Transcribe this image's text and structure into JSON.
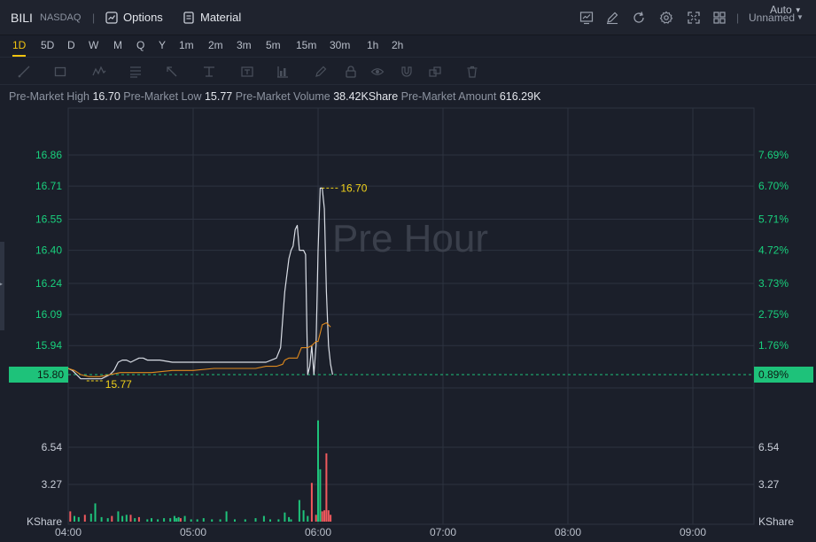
{
  "header": {
    "symbol": "BILI",
    "exchange": "NASDAQ",
    "separator": "|",
    "options_label": "Options",
    "material_label": "Material",
    "layout_name": "Unnamed",
    "right_icons": [
      "chart-icon",
      "edit-icon",
      "refresh-icon",
      "gear-icon",
      "fullscreen-icon",
      "grid-icon"
    ]
  },
  "periods": {
    "items": [
      "1D",
      "5D",
      "D",
      "W",
      "M",
      "Q",
      "Y",
      "1m",
      "2m",
      "3m",
      "5m",
      "15m",
      "30m",
      "1h",
      "2h"
    ],
    "active": "1D",
    "auto_label": "Auto"
  },
  "drawing_tools": [
    "trend-line-icon",
    "rectangle-icon",
    "pattern-icon",
    "fib-icon",
    "arrow-icon",
    "measure-icon",
    "text-icon",
    "bar-pattern-icon",
    "pencil-icon",
    "lock-icon",
    "eye-icon",
    "magnet-icon",
    "link-icon",
    "trash-icon"
  ],
  "premarket": {
    "high_label": "Pre-Market High",
    "high_value": "16.70",
    "low_label": "Pre-Market Low",
    "low_value": "15.77",
    "volume_label": "Pre-Market Volume",
    "volume_value": "38.42KShare",
    "amount_label": "Pre-Market Amount",
    "amount_value": "616.29K"
  },
  "colors": {
    "background": "#1b1f2a",
    "grid": "#2d3340",
    "price_line": "#d9dde5",
    "avg_line": "#e08a1e",
    "up": "#1ec27a",
    "down": "#f0595d",
    "label_yellow": "#f1d21a",
    "axis_green": "#19d07d",
    "current_badge": "#1ec27a",
    "watermark": "#3a3f4b"
  },
  "chart_data": {
    "type": "line",
    "watermark": "Pre Hour",
    "x_ticks": [
      "04:00",
      "05:00",
      "06:00",
      "07:00",
      "08:00",
      "09:00"
    ],
    "xlim": [
      "04:00",
      "09:30"
    ],
    "y_left_ticks": [
      "16.86",
      "16.71",
      "16.55",
      "16.40",
      "16.24",
      "16.09",
      "15.94"
    ],
    "y_right_ticks": [
      "7.69%",
      "6.70%",
      "5.71%",
      "4.72%",
      "3.73%",
      "2.75%",
      "1.76%"
    ],
    "ylim": [
      15.74,
      16.94
    ],
    "reference_price": 15.8,
    "current_price_label": "15.80",
    "current_pct_label": "0.89%",
    "high_marker": {
      "time": "06:01",
      "value": 16.7,
      "label": "16.70"
    },
    "low_marker": {
      "time": "04:08",
      "value": 15.77,
      "label": "15.77"
    },
    "series": [
      {
        "role": "price",
        "x": [
          "04:00",
          "04:02",
          "04:04",
          "04:06",
          "04:08",
          "04:12",
          "04:16",
          "04:20",
          "04:22",
          "04:24",
          "04:26",
          "04:28",
          "04:30",
          "04:32",
          "04:34",
          "04:36",
          "04:38",
          "04:40",
          "04:44",
          "04:50",
          "04:55",
          "05:00",
          "05:05",
          "05:10",
          "05:15",
          "05:20",
          "05:25",
          "05:30",
          "05:35",
          "05:40",
          "05:42",
          "05:44",
          "05:46",
          "05:47",
          "05:48",
          "05:49",
          "05:50",
          "05:51",
          "05:52",
          "05:53",
          "05:54",
          "05:55",
          "05:56",
          "05:57",
          "05:58",
          "05:59",
          "06:00",
          "06:01",
          "06:02",
          "06:03",
          "06:04",
          "06:05",
          "06:06",
          "06:07"
        ],
        "values": [
          15.83,
          15.82,
          15.8,
          15.78,
          15.78,
          15.78,
          15.78,
          15.8,
          15.82,
          15.86,
          15.87,
          15.87,
          15.86,
          15.87,
          15.88,
          15.88,
          15.87,
          15.87,
          15.87,
          15.86,
          15.86,
          15.86,
          15.86,
          15.86,
          15.86,
          15.86,
          15.86,
          15.86,
          15.86,
          15.88,
          15.93,
          16.2,
          16.36,
          16.4,
          16.42,
          16.5,
          16.52,
          16.4,
          16.4,
          16.4,
          16.38,
          15.8,
          15.84,
          15.94,
          15.8,
          15.94,
          16.4,
          16.7,
          16.7,
          16.6,
          16.2,
          15.94,
          15.85,
          15.8
        ]
      },
      {
        "role": "average",
        "x": [
          "04:00",
          "04:03",
          "04:06",
          "04:10",
          "04:15",
          "04:20",
          "04:25",
          "04:30",
          "04:40",
          "04:50",
          "05:00",
          "05:10",
          "05:20",
          "05:30",
          "05:35",
          "05:40",
          "05:43",
          "05:44",
          "05:46",
          "05:50",
          "05:52",
          "05:55",
          "05:57",
          "05:58",
          "05:59",
          "06:00",
          "06:01",
          "06:02",
          "06:04",
          "06:05",
          "06:06"
        ],
        "values": [
          15.83,
          15.82,
          15.8,
          15.79,
          15.79,
          15.8,
          15.81,
          15.81,
          15.81,
          15.82,
          15.82,
          15.83,
          15.83,
          15.83,
          15.84,
          15.84,
          15.85,
          15.87,
          15.88,
          15.88,
          15.93,
          15.93,
          15.94,
          15.95,
          15.96,
          15.96,
          16.0,
          16.04,
          16.05,
          16.04,
          16.03
        ]
      }
    ],
    "volume": {
      "y_ticks": [
        "6.54",
        "3.27"
      ],
      "unit_label": "KShare",
      "ylim": [
        0,
        10.5
      ],
      "bars": [
        {
          "x": "04:01",
          "v": 0.9,
          "dir": "down"
        },
        {
          "x": "04:03",
          "v": 0.5,
          "dir": "up"
        },
        {
          "x": "04:05",
          "v": 0.4,
          "dir": "up"
        },
        {
          "x": "04:08",
          "v": 0.6,
          "dir": "down"
        },
        {
          "x": "04:11",
          "v": 0.7,
          "dir": "up"
        },
        {
          "x": "04:13",
          "v": 1.6,
          "dir": "up"
        },
        {
          "x": "04:16",
          "v": 0.4,
          "dir": "up"
        },
        {
          "x": "04:19",
          "v": 0.3,
          "dir": "up"
        },
        {
          "x": "04:21",
          "v": 0.5,
          "dir": "down"
        },
        {
          "x": "04:24",
          "v": 0.9,
          "dir": "up"
        },
        {
          "x": "04:26",
          "v": 0.5,
          "dir": "up"
        },
        {
          "x": "04:28",
          "v": 0.6,
          "dir": "up"
        },
        {
          "x": "04:30",
          "v": 0.6,
          "dir": "down"
        },
        {
          "x": "04:32",
          "v": 0.3,
          "dir": "up"
        },
        {
          "x": "04:34",
          "v": 0.4,
          "dir": "down"
        },
        {
          "x": "04:38",
          "v": 0.2,
          "dir": "up"
        },
        {
          "x": "04:40",
          "v": 0.3,
          "dir": "up"
        },
        {
          "x": "04:43",
          "v": 0.2,
          "dir": "up"
        },
        {
          "x": "04:46",
          "v": 0.3,
          "dir": "up"
        },
        {
          "x": "04:49",
          "v": 0.3,
          "dir": "up"
        },
        {
          "x": "04:51",
          "v": 0.5,
          "dir": "up"
        },
        {
          "x": "04:52",
          "v": 0.3,
          "dir": "up"
        },
        {
          "x": "04:53",
          "v": 0.4,
          "dir": "up"
        },
        {
          "x": "04:54",
          "v": 0.3,
          "dir": "down"
        },
        {
          "x": "04:56",
          "v": 0.5,
          "dir": "up"
        },
        {
          "x": "04:59",
          "v": 0.2,
          "dir": "up"
        },
        {
          "x": "05:02",
          "v": 0.2,
          "dir": "up"
        },
        {
          "x": "05:05",
          "v": 0.3,
          "dir": "up"
        },
        {
          "x": "05:09",
          "v": 0.2,
          "dir": "up"
        },
        {
          "x": "05:13",
          "v": 0.2,
          "dir": "up"
        },
        {
          "x": "05:16",
          "v": 0.9,
          "dir": "up"
        },
        {
          "x": "05:20",
          "v": 0.2,
          "dir": "up"
        },
        {
          "x": "05:25",
          "v": 0.2,
          "dir": "up"
        },
        {
          "x": "05:30",
          "v": 0.3,
          "dir": "up"
        },
        {
          "x": "05:34",
          "v": 0.5,
          "dir": "up"
        },
        {
          "x": "05:37",
          "v": 0.2,
          "dir": "up"
        },
        {
          "x": "05:41",
          "v": 0.2,
          "dir": "up"
        },
        {
          "x": "05:44",
          "v": 0.8,
          "dir": "up"
        },
        {
          "x": "05:46",
          "v": 0.4,
          "dir": "up"
        },
        {
          "x": "05:47",
          "v": 0.2,
          "dir": "up"
        },
        {
          "x": "05:51",
          "v": 1.9,
          "dir": "up"
        },
        {
          "x": "05:53",
          "v": 1.0,
          "dir": "up"
        },
        {
          "x": "05:55",
          "v": 0.5,
          "dir": "up"
        },
        {
          "x": "05:57",
          "v": 3.4,
          "dir": "down"
        },
        {
          "x": "05:59",
          "v": 0.6,
          "dir": "down"
        },
        {
          "x": "06:00",
          "v": 8.9,
          "dir": "up"
        },
        {
          "x": "06:01",
          "v": 4.6,
          "dir": "up"
        },
        {
          "x": "06:02",
          "v": 0.9,
          "dir": "down"
        },
        {
          "x": "06:03",
          "v": 1.0,
          "dir": "down"
        },
        {
          "x": "06:04",
          "v": 6.0,
          "dir": "down"
        },
        {
          "x": "06:05",
          "v": 1.0,
          "dir": "down"
        },
        {
          "x": "06:06",
          "v": 0.6,
          "dir": "down"
        }
      ]
    }
  }
}
